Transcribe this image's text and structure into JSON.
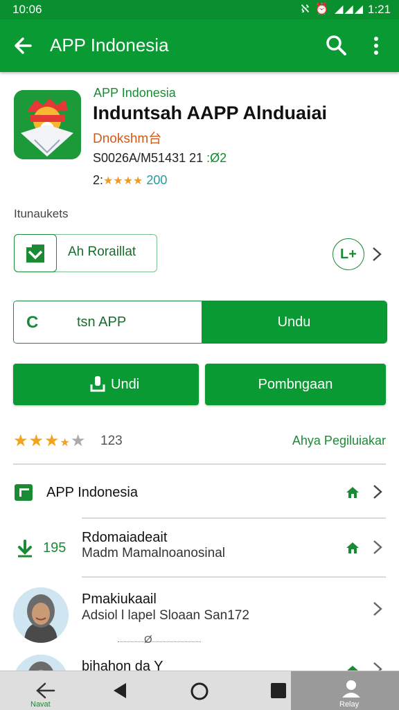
{
  "status_bar": {
    "time": "10:06",
    "icons": "ℵ ⏰ ◢◢◢",
    "clock": "1:21"
  },
  "app_bar": {
    "title": "APP Indonesia"
  },
  "app": {
    "subtitle": "APP Indonesia",
    "title": "Induntsah AAPP Alnduaiai",
    "developer": "Dnokshm台",
    "code": "S0026A/M51431 21",
    "code_suffix": ":Ø2",
    "rating_prefix": "2:",
    "rating_stars": "★★★★",
    "rating_count": "200"
  },
  "section": {
    "label": "Itunaukets",
    "install_chip_label": "Ah Roraillat",
    "badge_text": "L+"
  },
  "segmented": {
    "left_icon": "C",
    "left_label": "tsn APP",
    "right_label": "Undu"
  },
  "buttons": {
    "download_label": "Undi",
    "compare_label": "Pombngaan"
  },
  "rating_row": {
    "stars_filled": "★★★",
    "star_half": "★",
    "star_empty": "★",
    "value": "123",
    "link": "Ahya Pegiluiakar"
  },
  "list": [
    {
      "title": "APP Indonesia",
      "subtitle": ""
    },
    {
      "prefix": "195",
      "title": "Rdomaiadeait",
      "subtitle": "Madm  Mamalnoanosinal"
    },
    {
      "title": "Pmakiukaail",
      "subtitle": "Adsiol l lapel Sloaan San172"
    },
    {
      "title": "bihahon da Y",
      "subtitle": ""
    }
  ],
  "small_marker": "Ø",
  "nav": {
    "back_label": "Navat",
    "profile_label": "Relay"
  },
  "colors": {
    "primary": "#0a9a33",
    "status": "#0a8f2e",
    "star": "#f3a21b",
    "developer": "#d15b1b"
  }
}
